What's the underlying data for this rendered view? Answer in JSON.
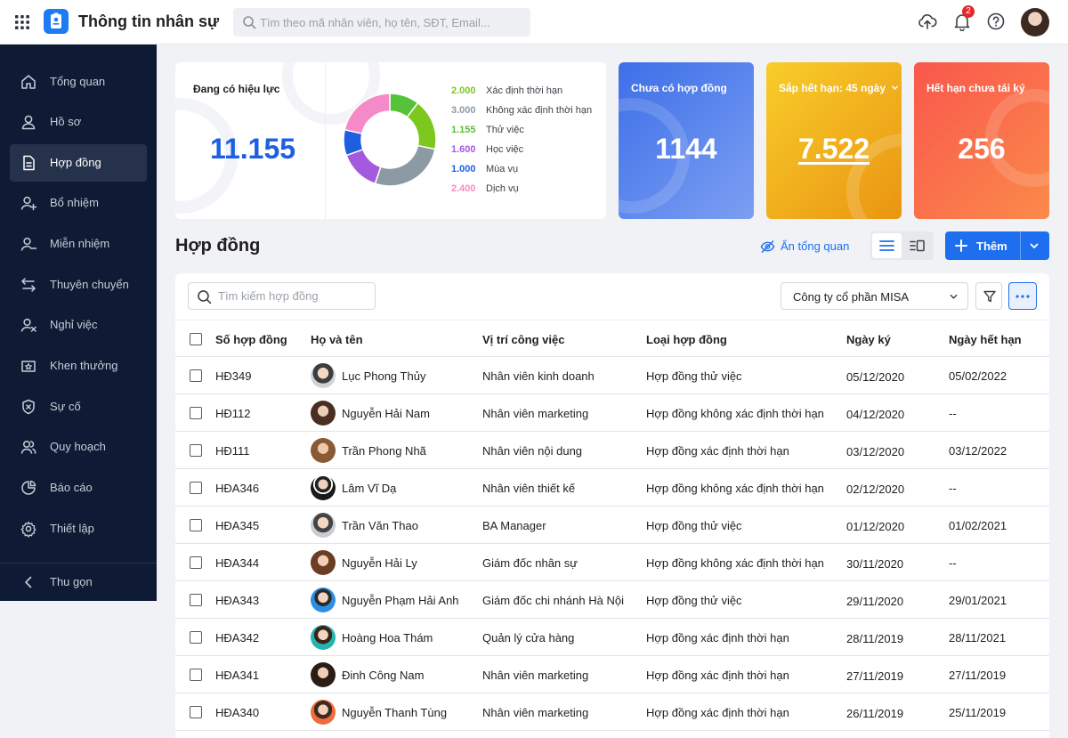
{
  "app": {
    "title": "Thông tin nhân sự"
  },
  "search": {
    "placeholder": "Tìm theo mã nhân viên, họ tên, SĐT, Email..."
  },
  "notifications": {
    "count": "2"
  },
  "sidebar": {
    "items": [
      {
        "label": "Tổng quan",
        "icon": "home-icon"
      },
      {
        "label": "Hồ sơ",
        "icon": "user-icon"
      },
      {
        "label": "Hợp đồng",
        "icon": "document-icon",
        "active": true
      },
      {
        "label": "Bổ nhiệm",
        "icon": "user-plus-icon"
      },
      {
        "label": "Miễn nhiệm",
        "icon": "user-minus-icon"
      },
      {
        "label": "Thuyên chuyển",
        "icon": "transfer-icon"
      },
      {
        "label": "Nghỉ việc",
        "icon": "user-x-icon"
      },
      {
        "label": "Khen thưởng",
        "icon": "award-icon"
      },
      {
        "label": "Sự cố",
        "icon": "shield-x-icon"
      },
      {
        "label": "Quy hoạch",
        "icon": "users-icon"
      },
      {
        "label": "Báo cáo",
        "icon": "chart-icon"
      },
      {
        "label": "Thiết lập",
        "icon": "gear-icon"
      }
    ],
    "collapse_label": "Thu gọn"
  },
  "summary": {
    "active": {
      "label": "Đang có hiệu lực",
      "value": "11.155",
      "breakdown": [
        {
          "value": "2.000",
          "label": "Xác định thời hạn",
          "color": "#7cc81e"
        },
        {
          "value": "3.000",
          "label": "Không xác định thời hạn",
          "color": "#8c9aa4"
        },
        {
          "value": "1.155",
          "label": "Thử việc",
          "color": "#55c23a"
        },
        {
          "value": "1.600",
          "label": "Học việc",
          "color": "#a35adf"
        },
        {
          "value": "1.000",
          "label": "Mùa vụ",
          "color": "#1d5fe0"
        },
        {
          "value": "2.400",
          "label": "Dịch vụ",
          "color": "#f58ac8"
        }
      ]
    },
    "no_contract": {
      "label": "Chưa có hợp đồng",
      "value": "1144"
    },
    "expiring": {
      "label": "Sắp hết hạn: 45 ngày",
      "value": "7.522"
    },
    "expired": {
      "label": "Hết hạn chưa tái ký",
      "value": "256"
    }
  },
  "section": {
    "title": "Hợp đồng",
    "hide_overview": "Ẩn tổng quan",
    "add_label": "Thêm"
  },
  "table": {
    "search_placeholder": "Tìm kiếm hợp đồng",
    "company": "Công ty cổ phần MISA",
    "columns": [
      "Số hợp đồng",
      "Họ và tên",
      "Vị trí công việc",
      "Loại hợp đồng",
      "Ngày ký",
      "Ngày hết hạn"
    ],
    "rows": [
      {
        "id": "HĐ349",
        "name": "Lục Phong Thủy",
        "position": "Nhân viên kinh doanh",
        "type": "Hợp đồng thử việc",
        "signed": "05/12/2020",
        "expires": "05/02/2022"
      },
      {
        "id": "HĐ112",
        "name": "Nguyễn Hải Nam",
        "position": "Nhân viên marketing",
        "type": "Hợp đồng không xác định thời hạn",
        "signed": "04/12/2020",
        "expires": "--"
      },
      {
        "id": "HĐ111",
        "name": "Trần Phong Nhã",
        "position": "Nhân viên nội dung",
        "type": "Hợp đồng xác định thời hạn",
        "signed": "03/12/2020",
        "expires": "03/12/2022"
      },
      {
        "id": "HĐA346",
        "name": "Lâm Vĩ Dạ",
        "position": "Nhân viên thiết kế",
        "type": "Hợp đồng không xác định thời hạn",
        "signed": "02/12/2020",
        "expires": "--"
      },
      {
        "id": "HĐA345",
        "name": "Trần Văn Thao",
        "position": "BA Manager",
        "type": "Hợp đồng thử việc",
        "signed": "01/12/2020",
        "expires": "01/02/2021"
      },
      {
        "id": "HĐA344",
        "name": "Nguyễn Hải Ly",
        "position": "Giám đốc nhân sự",
        "type": "Hợp đồng không xác định thời hạn",
        "signed": "30/11/2020",
        "expires": "--"
      },
      {
        "id": "HĐA343",
        "name": "Nguyễn Phạm Hải Anh",
        "position": "Giám đốc chi nhánh Hà Nội",
        "type": "Hợp đồng thử việc",
        "signed": "29/11/2020",
        "expires": "29/01/2021"
      },
      {
        "id": "HĐA342",
        "name": "Hoàng Hoa Thám",
        "position": "Quản lý cửa hàng",
        "type": "Hợp đồng xác định thời hạn",
        "signed": "28/11/2019",
        "expires": "28/11/2021"
      },
      {
        "id": "HĐA341",
        "name": "Đinh Công Nam",
        "position": "Nhân viên marketing",
        "type": "Hợp đồng xác định thời hạn",
        "signed": "27/11/2019",
        "expires": "27/11/2019"
      },
      {
        "id": "HĐA340",
        "name": "Nguyễn Thanh Tùng",
        "position": "Nhân viên marketing",
        "type": "Hợp đồng xác định thời hạn",
        "signed": "26/11/2019",
        "expires": "25/11/2019"
      }
    ]
  },
  "colors": {
    "accent": "#1e6ff0",
    "sidebar_bg": "#0f1b35",
    "value_blue": "#1d5fe0"
  }
}
